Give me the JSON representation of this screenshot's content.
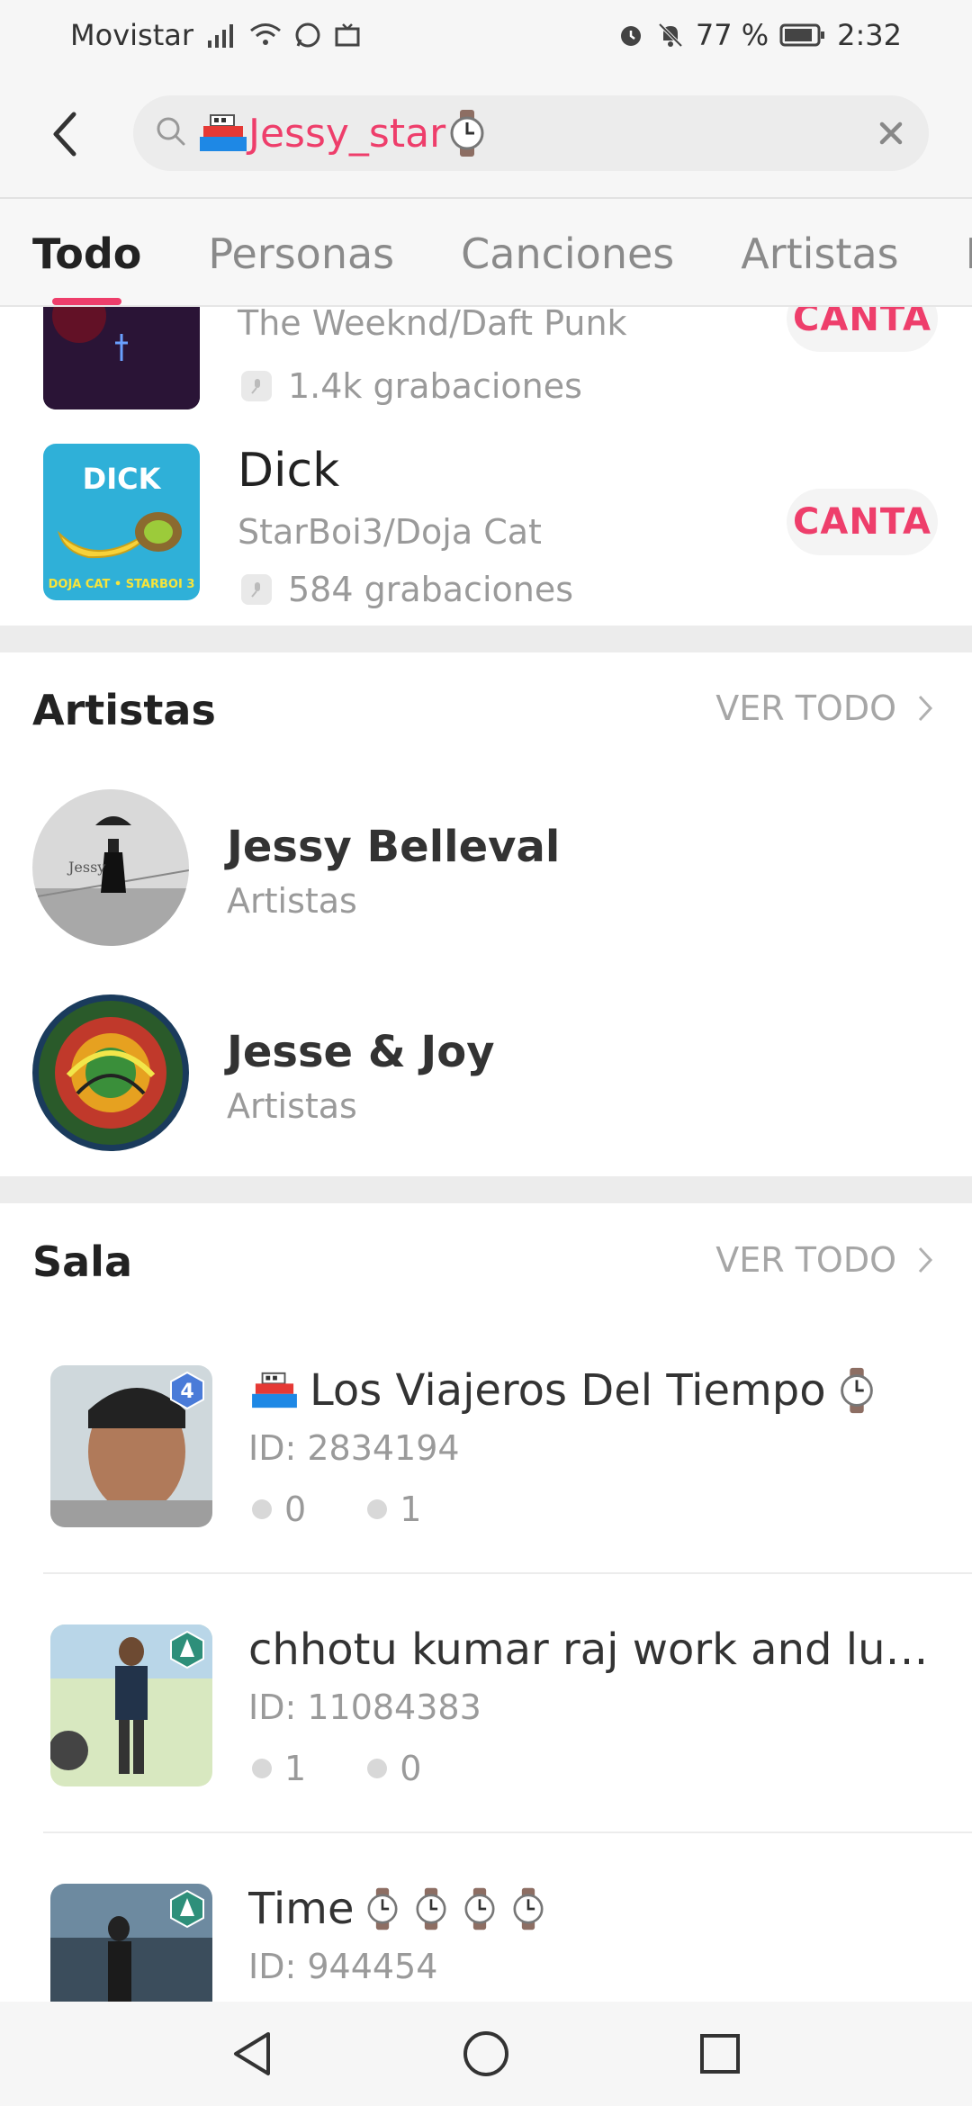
{
  "status_bar": {
    "carrier": "Movistar",
    "battery": "77 %",
    "time": "2:32"
  },
  "search": {
    "query": "Jessy_star"
  },
  "tabs": [
    {
      "label": "Todo",
      "active": true
    },
    {
      "label": "Personas",
      "active": false
    },
    {
      "label": "Canciones",
      "active": false
    },
    {
      "label": "Artistas",
      "active": false
    },
    {
      "label": "Mo",
      "active": false
    }
  ],
  "songs": [
    {
      "title": "",
      "artist": "The Weeknd/Daft Punk",
      "recordings": "1.4k grabaciones",
      "action": "CANTA"
    },
    {
      "title": "Dick",
      "artist": "StarBoi3/Doja Cat",
      "recordings": "584 grabaciones",
      "action": "CANTA",
      "cover_text_top": "DICK",
      "cover_text_bottom": "DOJA CAT • STARBOI 3"
    }
  ],
  "artists_section": {
    "title": "Artistas",
    "see_all": "VER TODO",
    "items": [
      {
        "name": "Jessy Belleval",
        "type": "Artistas"
      },
      {
        "name": "Jesse & Joy",
        "type": "Artistas"
      }
    ]
  },
  "rooms_section": {
    "title": "Sala",
    "see_all": "VER TODO",
    "items": [
      {
        "name": "Los Viajeros Del Tiempo",
        "id": "ID: 2834194",
        "stat1": "0",
        "stat2": "1",
        "badge": "4"
      },
      {
        "name": "chhotu kumar raj work and lu…",
        "id": "ID: 11084383",
        "stat1": "1",
        "stat2": "0"
      },
      {
        "name": "Time",
        "id": "ID: 944454"
      }
    ]
  },
  "colors": {
    "accent": "#ee3e6b",
    "muted": "#9a9a9a",
    "background": "#f6f6f6"
  }
}
